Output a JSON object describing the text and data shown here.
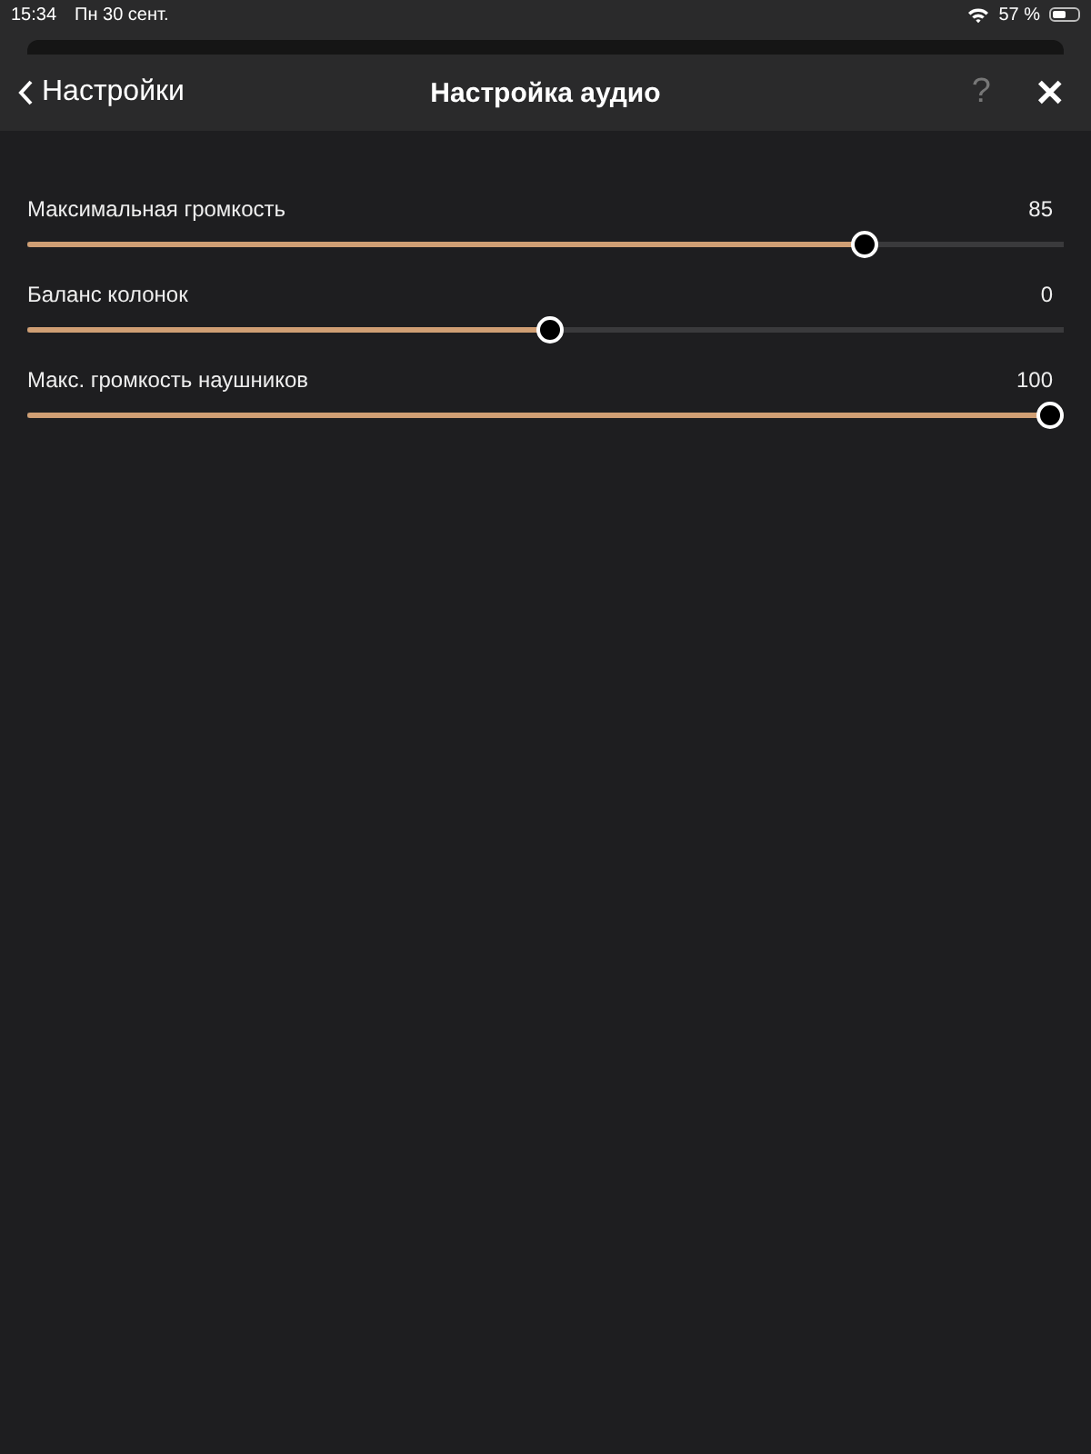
{
  "status_bar": {
    "time": "15:34",
    "date": "Пн 30 сент.",
    "battery": "57 %"
  },
  "nav_bar": {
    "back": "Настройки",
    "title": "Настройка аудио",
    "help": "?",
    "close": "✕"
  },
  "sliders": [
    {
      "label": "Максимальная громкость",
      "reading": "85",
      "level": 0.816
    },
    {
      "label": "Баланс колонок",
      "reading": "0",
      "level": 0.505
    },
    {
      "label": "Макс. громкость наушников",
      "reading": "100",
      "level": 1.0
    }
  ]
}
